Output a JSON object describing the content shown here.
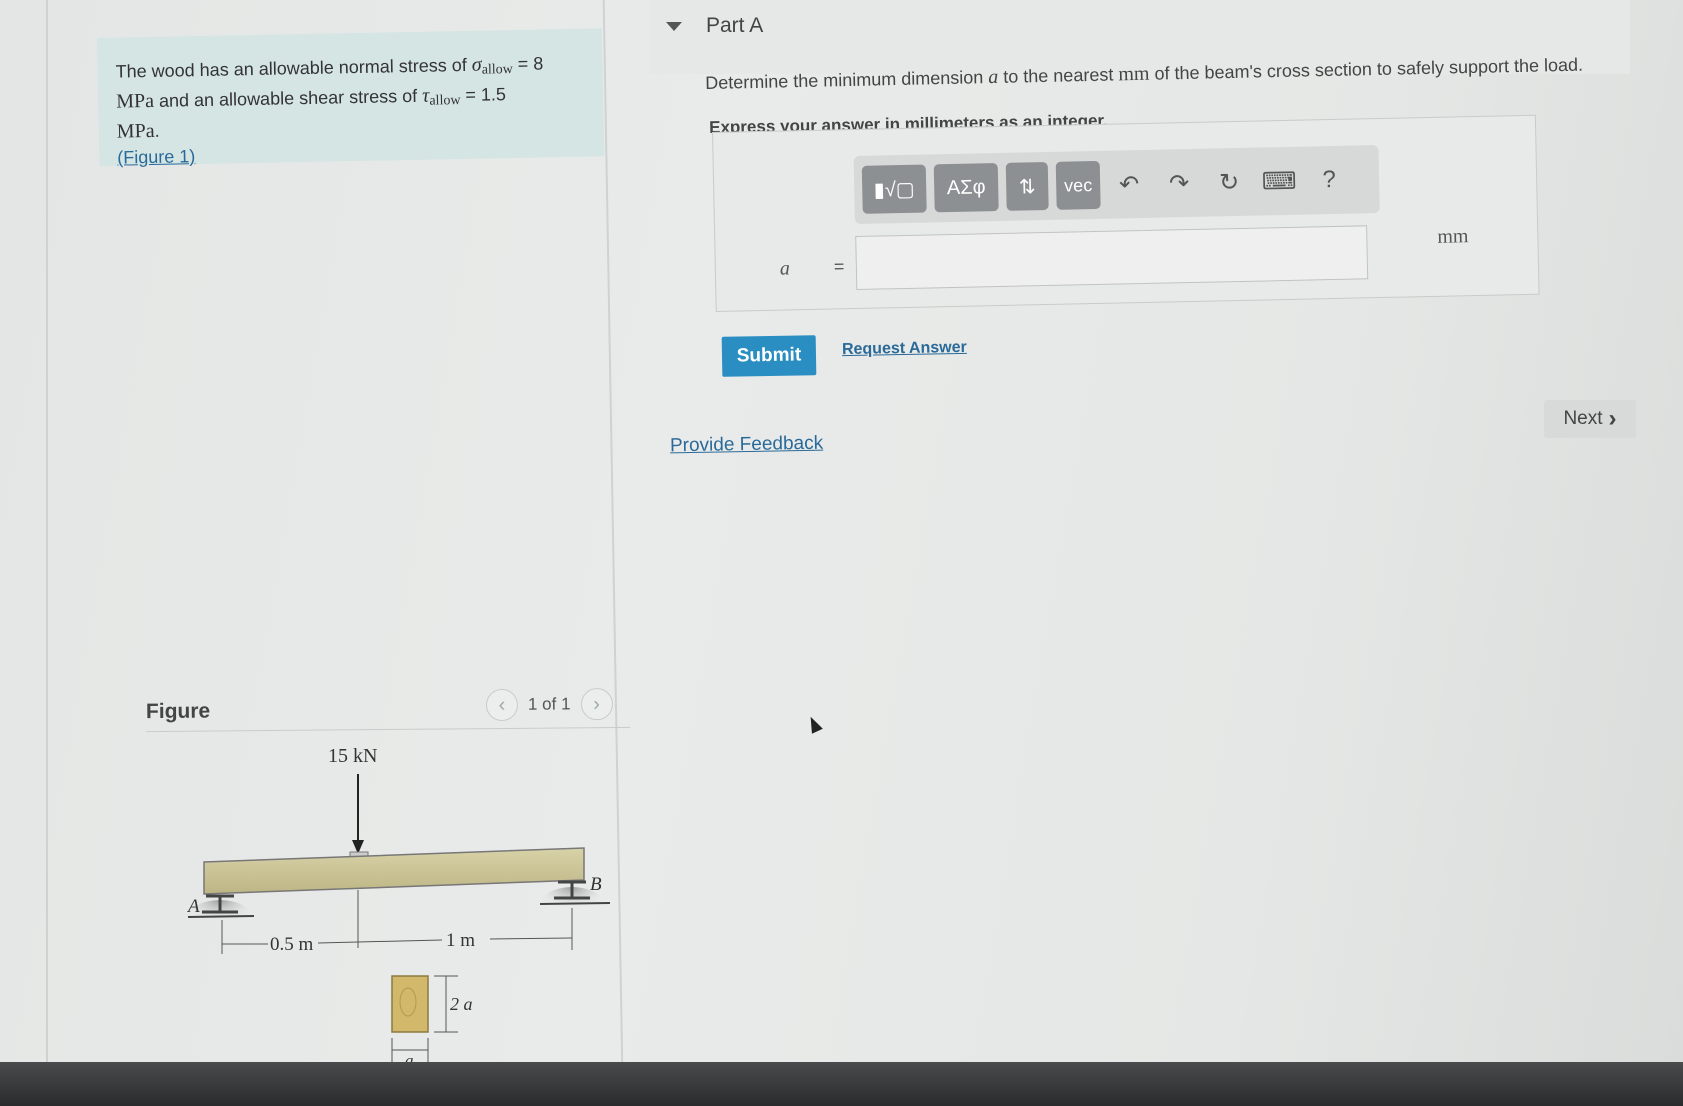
{
  "problem": {
    "text_1": "The wood has an allowable normal stress of ",
    "sigma": "σ",
    "sigma_sub": "allow",
    "sigma_value": " = 8",
    "unit_mpa_1": "MPa",
    "text_2": " and an allowable shear stress of ",
    "tau": "τ",
    "tau_sub": "allow",
    "tau_value": " = 1.5",
    "unit_mpa_2": "MPa",
    "figure_link": "(Figure 1)"
  },
  "figure": {
    "title": "Figure",
    "pager_text": "1 of 1",
    "load_label": "15 kN",
    "support_a": "A",
    "support_b": "B",
    "dim_left": "0.5 m",
    "dim_right": "1 m",
    "height_label": "2 a",
    "width_label": "a"
  },
  "part": {
    "title": "Part A",
    "question_1": "Determine the minimum dimension ",
    "question_var": "a",
    "question_2": " to the nearest ",
    "question_unit": "mm",
    "question_3": " of the beam's cross section to safely support the load.",
    "instruction": "Express your answer in millimeters as an integer."
  },
  "toolbar": {
    "templates": "▮√▢",
    "greek": "ΑΣφ",
    "arrows": "⇅",
    "vec": "vec",
    "undo": "↶",
    "redo": "↷",
    "reset": "↻",
    "keyboard": "⌨",
    "help": "?"
  },
  "answer": {
    "variable": "a",
    "equals": "=",
    "value": "",
    "unit": "mm"
  },
  "actions": {
    "submit": "Submit",
    "request_answer": "Request Answer",
    "next": "Next",
    "next_chevron": "›",
    "provide_feedback": "Provide Feedback"
  },
  "colors": {
    "submit_bg": "#2a8ec2",
    "link": "#2a6a99",
    "problem_bg": "#d5e5e4",
    "toolbar_btn": "#8c9092"
  }
}
